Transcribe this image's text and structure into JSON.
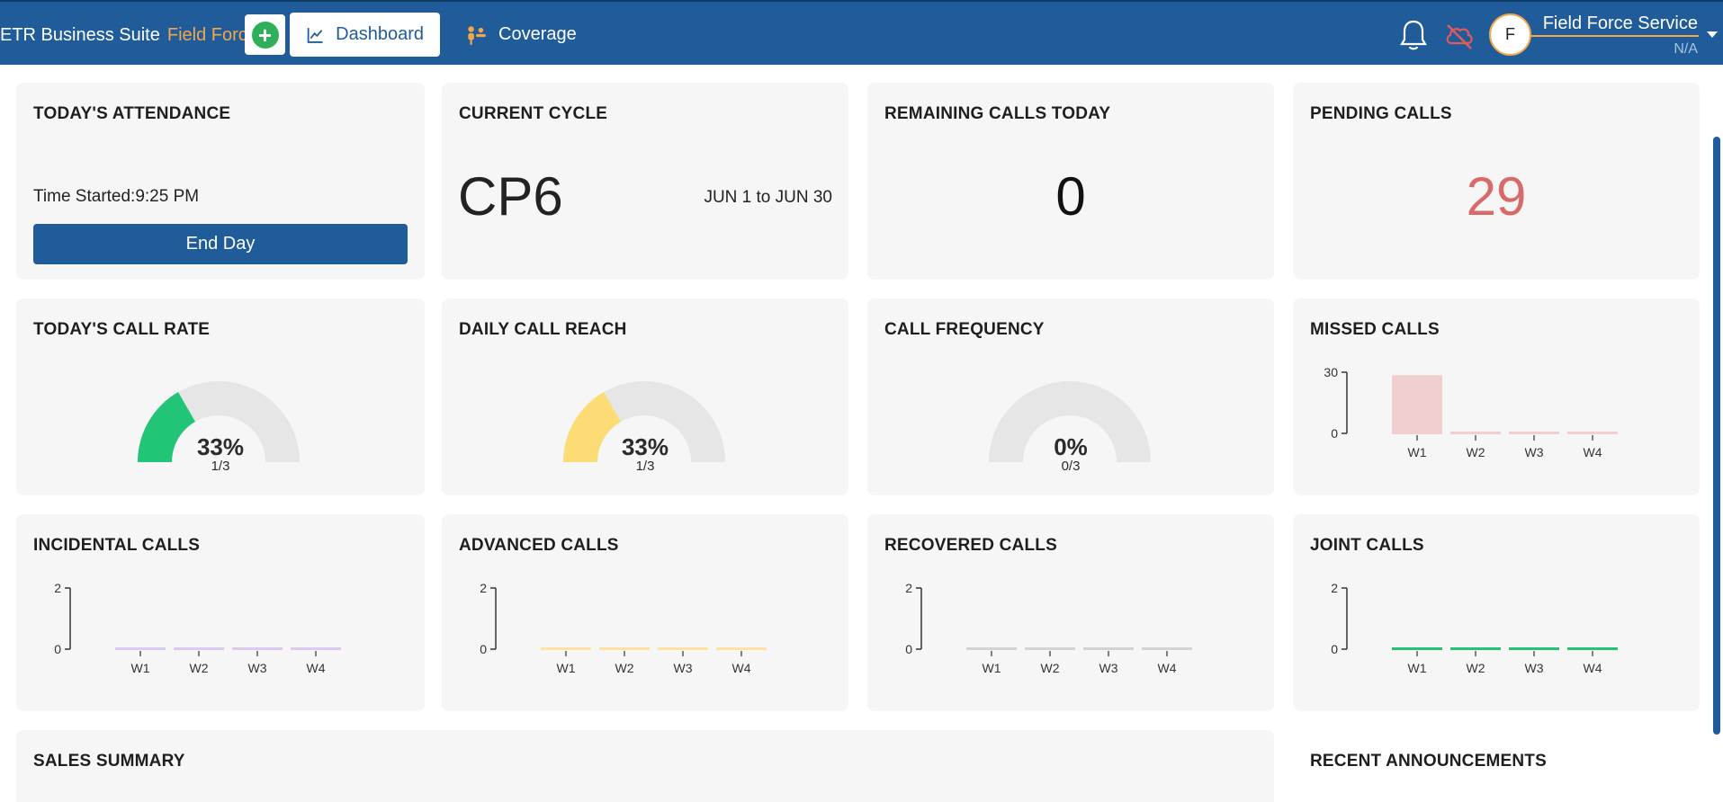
{
  "header": {
    "brand": "ETR Business Suite",
    "brand_accent": "Field Force",
    "tabs": [
      {
        "label": "Dashboard",
        "icon": "line-chart-icon"
      },
      {
        "label": "Coverage",
        "icon": "people-icon"
      }
    ],
    "user": {
      "initial": "F",
      "name": "Field Force Service",
      "role": "N/A"
    }
  },
  "colors": {
    "brand": "#1f5c99",
    "accent": "#f4a64a",
    "call_rate": "#22c576",
    "call_reach": "#fddc76",
    "pending": "#d86a6a",
    "missed": "#f2cfcf",
    "incidental": "#dcc9ef",
    "advanced": "#fde2a3",
    "recovered": "#d3d3d3",
    "joint": "#22c576"
  },
  "cards": {
    "attendance": {
      "title": "TODAY'S ATTENDANCE",
      "time_started": "Time Started:9:25 PM",
      "button": "End Day"
    },
    "cycle": {
      "title": "CURRENT CYCLE",
      "code": "CP6",
      "range": "JUN 1 to JUN 30"
    },
    "remaining": {
      "title": "REMAINING CALLS TODAY",
      "value": "0"
    },
    "pending": {
      "title": "PENDING CALLS",
      "value": "29"
    },
    "call_rate": {
      "title": "TODAY'S CALL RATE",
      "percent": "33%",
      "ratio": "1/3",
      "fraction": 0.3333
    },
    "call_reach": {
      "title": "DAILY CALL REACH",
      "percent": "33%",
      "ratio": "1/3",
      "fraction": 0.3333
    },
    "call_frequency": {
      "title": "CALL FREQUENCY",
      "percent": "0%",
      "ratio": "0/3",
      "fraction": 0
    },
    "missed": {
      "title": "MISSED CALLS"
    },
    "incidental": {
      "title": "INCIDENTAL CALLS"
    },
    "advanced": {
      "title": "ADVANCED CALLS"
    },
    "recovered": {
      "title": "RECOVERED CALLS"
    },
    "joint": {
      "title": "JOINT CALLS"
    },
    "sales": {
      "title": "SALES SUMMARY"
    },
    "announcements": {
      "title": "RECENT ANNOUNCEMENTS"
    }
  },
  "chart_data": [
    {
      "id": "missed",
      "type": "bar",
      "categories": [
        "W1",
        "W2",
        "W3",
        "W4"
      ],
      "values": [
        29,
        0,
        0,
        0
      ],
      "ylim": [
        0,
        30
      ],
      "yticks": [
        0,
        30
      ]
    },
    {
      "id": "incidental",
      "type": "bar",
      "categories": [
        "W1",
        "W2",
        "W3",
        "W4"
      ],
      "values": [
        0,
        0,
        0,
        0
      ],
      "ylim": [
        0,
        2
      ],
      "yticks": [
        0,
        2
      ]
    },
    {
      "id": "advanced",
      "type": "bar",
      "categories": [
        "W1",
        "W2",
        "W3",
        "W4"
      ],
      "values": [
        0,
        0,
        0,
        0
      ],
      "ylim": [
        0,
        2
      ],
      "yticks": [
        0,
        2
      ]
    },
    {
      "id": "recovered",
      "type": "bar",
      "categories": [
        "W1",
        "W2",
        "W3",
        "W4"
      ],
      "values": [
        0,
        0,
        0,
        0
      ],
      "ylim": [
        0,
        2
      ],
      "yticks": [
        0,
        2
      ]
    },
    {
      "id": "joint",
      "type": "bar",
      "categories": [
        "W1",
        "W2",
        "W3",
        "W4"
      ],
      "values": [
        0,
        0,
        0,
        0
      ],
      "ylim": [
        0,
        2
      ],
      "yticks": [
        0,
        2
      ]
    }
  ]
}
